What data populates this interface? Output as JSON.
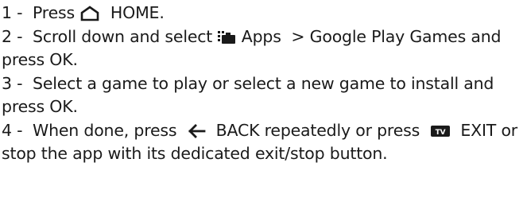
{
  "steps": [
    {
      "number": "1 -",
      "parts": {
        "a": "Press",
        "home_icon": "home-icon",
        "b": "HOME."
      }
    },
    {
      "number": "2 -",
      "parts": {
        "a": "Scroll down and select",
        "apps_icon": "apps-folder-icon",
        "b": "Apps",
        "c": "> Google Play Games",
        "d": "and press",
        "e": "OK",
        "f": "."
      }
    },
    {
      "number": "3 -",
      "parts": {
        "a": "Select a game to play or select a new game to install and press",
        "b": "OK",
        "c": "."
      }
    },
    {
      "number": "4 -",
      "parts": {
        "a": "When done, press",
        "back_icon": "back-arrow-icon",
        "b": "BACK",
        "c": "repeatedly or press",
        "tv_icon": "tv-icon",
        "d": "EXIT",
        "e": "or stop the app with its dedicated exit/stop button."
      }
    }
  ]
}
